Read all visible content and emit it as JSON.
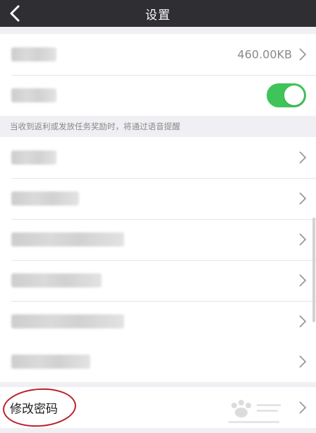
{
  "header": {
    "title": "设置",
    "back_icon": "chevron-left-icon"
  },
  "settings": {
    "cache_value": "460.00KB",
    "voice_toggle_on": true,
    "hint_text": "当收到返利或发放任务奖励时，将通过语音提醒",
    "change_password_label": "修改密码"
  },
  "colors": {
    "titlebar": "#2e2e33",
    "toggle_on": "#3fc45a",
    "annotation_circle": "#b8202b",
    "background": "#efeff4"
  }
}
